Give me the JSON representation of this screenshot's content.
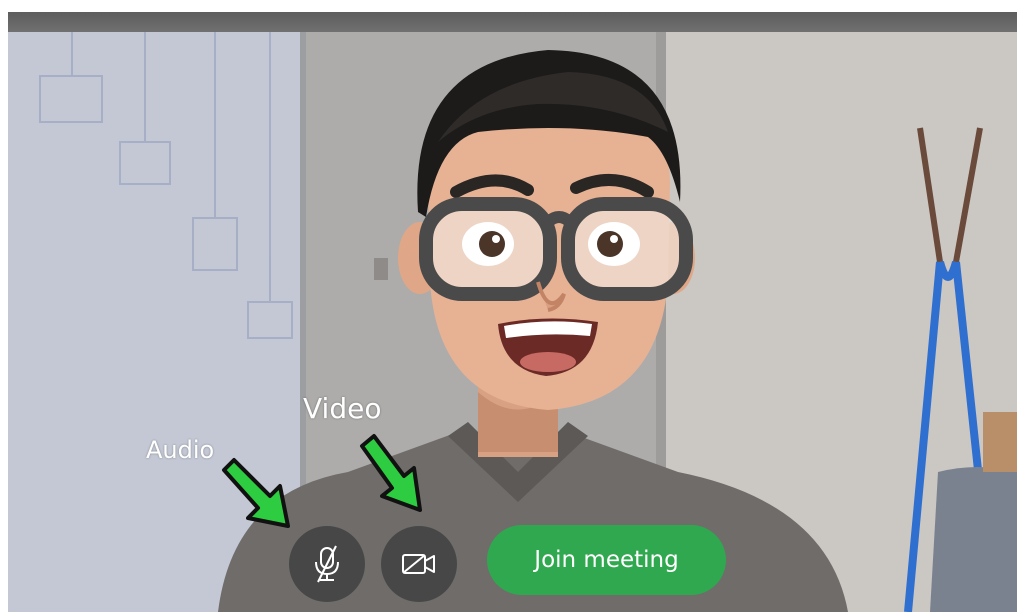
{
  "annotations": {
    "video_label": "Video",
    "audio_label": "Audio",
    "arrow_color": "#2ecc40"
  },
  "controls": {
    "mic_icon": "microphone-muted-icon",
    "video_icon": "video-camera-off-icon",
    "join_label": "Join meeting",
    "join_color": "#30a84f",
    "control_bg": "#444444"
  },
  "video_preview": {
    "avatar": "memoji-avatar-with-glasses",
    "background": "office-whiteboard-and-coat-rack"
  }
}
